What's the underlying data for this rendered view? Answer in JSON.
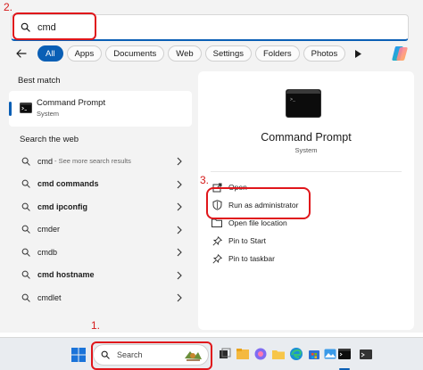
{
  "annotations": {
    "step1": "1.",
    "step2": "2.",
    "step3": "3."
  },
  "search": {
    "query": "cmd",
    "icon": "search-icon"
  },
  "filters": {
    "items": [
      "All",
      "Apps",
      "Documents",
      "Web",
      "Settings",
      "Folders",
      "Photos"
    ],
    "active": "All"
  },
  "best_match": {
    "heading": "Best match",
    "name": "Command Prompt",
    "type": "System"
  },
  "web": {
    "heading": "Search the web",
    "items": [
      {
        "query": "cmd",
        "suffix": "- See more search results"
      },
      {
        "query": "cmd commands",
        "suffix": ""
      },
      {
        "query": "cmd ipconfig",
        "suffix": ""
      },
      {
        "query": "cmder",
        "suffix": ""
      },
      {
        "query": "cmdb",
        "suffix": ""
      },
      {
        "query": "cmd hostname",
        "suffix": ""
      },
      {
        "query": "cmdlet",
        "suffix": ""
      }
    ]
  },
  "detail": {
    "title": "Command Prompt",
    "subtitle": "System",
    "actions": [
      {
        "label": "Open",
        "icon": "open-icon"
      },
      {
        "label": "Run as administrator",
        "icon": "shield-icon"
      },
      {
        "label": "Open file location",
        "icon": "folder-icon"
      },
      {
        "label": "Pin to Start",
        "icon": "pin-icon"
      },
      {
        "label": "Pin to taskbar",
        "icon": "pin-icon"
      }
    ]
  },
  "taskbar": {
    "search_label": "Search"
  },
  "colors": {
    "accent": "#0a5fb5",
    "annotation_red": "#e0161b"
  }
}
